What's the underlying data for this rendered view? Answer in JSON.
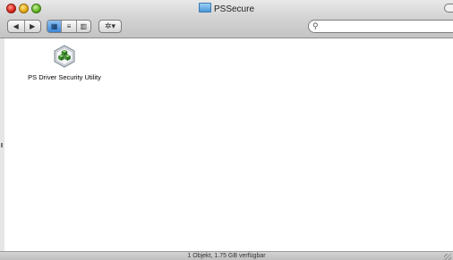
{
  "window": {
    "title": "PSSecure",
    "title_icon": "folder-icon"
  },
  "toolbar": {
    "back_icon": "◀",
    "forward_icon": "▶",
    "view_icons": [
      "▦",
      "≡",
      "▥"
    ],
    "action_icon": "✲▾",
    "search_icon": "⚲",
    "search_placeholder": ""
  },
  "files": [
    {
      "name": "PS Driver Security Utility",
      "icon": "green-cubes-app-icon"
    }
  ],
  "status": {
    "text": "1 Objekt, 1.75 GB verfügbar"
  },
  "colors": {
    "accent": "#3d86d6",
    "close": "#d8231b",
    "minimize": "#e2a90f",
    "zoom": "#5fb321"
  }
}
